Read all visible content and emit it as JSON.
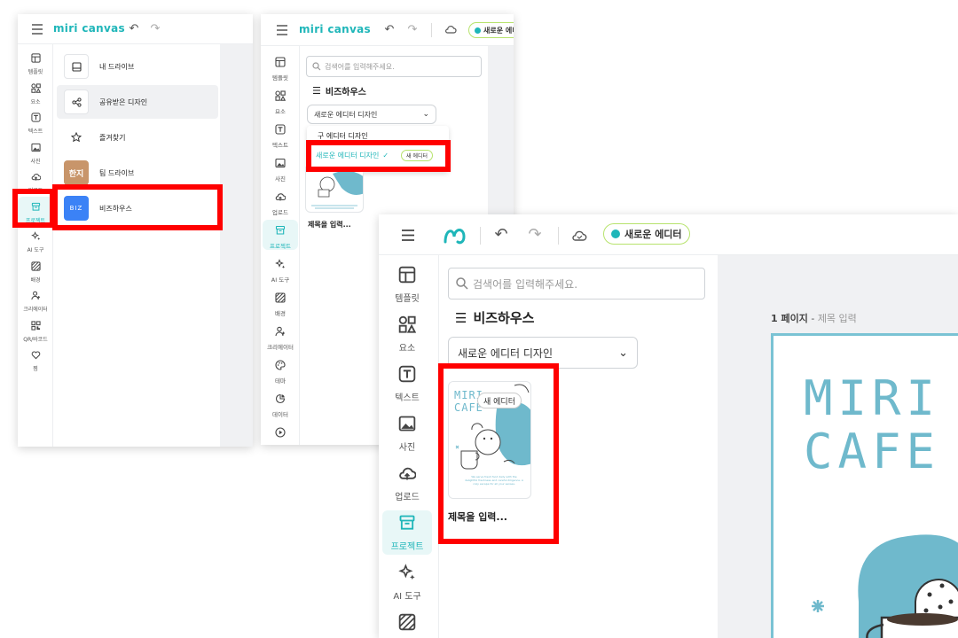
{
  "app": {
    "logo": "miri canvas"
  },
  "panel1": {
    "rail": [
      {
        "label": "템플릿",
        "icon": "template-icon"
      },
      {
        "label": "요소",
        "icon": "elements-icon"
      },
      {
        "label": "텍스트",
        "icon": "text-icon"
      },
      {
        "label": "사진",
        "icon": "photo-icon"
      },
      {
        "label": "업로드",
        "icon": "upload-icon"
      },
      {
        "label": "프로젝트",
        "icon": "project-icon"
      },
      {
        "label": "AI 도구",
        "icon": "ai-tool-icon"
      },
      {
        "label": "배경",
        "icon": "background-icon"
      },
      {
        "label": "크리에이터",
        "icon": "creator-icon"
      },
      {
        "label": "QR/바코드",
        "icon": "qr-icon"
      },
      {
        "label": "찜",
        "icon": "heart-icon"
      }
    ],
    "menu": [
      {
        "label": "내 드라이브",
        "icon": "drive-icon"
      },
      {
        "label": "공유받은 디자인",
        "icon": "share-icon"
      },
      {
        "label": "즐겨찾기",
        "icon": "star-icon"
      },
      {
        "label": "팀 드라이브",
        "icon": "team-badge",
        "badge": "한지"
      },
      {
        "label": "비즈하우스",
        "icon": "biz-badge",
        "badge": "Biz"
      }
    ]
  },
  "panel2": {
    "badge": "새로운 에디터",
    "search_placeholder": "검색어를 입력해주세요.",
    "section_title": "비즈하우스",
    "dropdown_value": "새로운 에디터 디자인",
    "dropdown_options": [
      {
        "label": "구 에디터 디자인"
      },
      {
        "label": "새로운 에디터 디자인",
        "badge": "새 에디터"
      }
    ],
    "thumb_title": "제목을 입력...",
    "rail": [
      {
        "label": "템플릿"
      },
      {
        "label": "요소"
      },
      {
        "label": "텍스트"
      },
      {
        "label": "사진"
      },
      {
        "label": "업로드"
      },
      {
        "label": "프로젝트"
      },
      {
        "label": "AI 도구"
      },
      {
        "label": "배경"
      },
      {
        "label": "크리에이터"
      },
      {
        "label": "테마"
      },
      {
        "label": "데이터"
      },
      {
        "label": "동영상"
      }
    ]
  },
  "panel3": {
    "badge": "새로운 에디터",
    "search_placeholder": "검색어를 입력해주세요.",
    "section_title": "비즈하우스",
    "dropdown_value": "새로운 에디터 디자인",
    "thumb_badge": "새 에디터",
    "thumb_title": "제목을 입력...",
    "thumb_art_title": "MIRI CAFE",
    "thumb_art_caption": "We serve fresh food daily with the delightful freshness and careful diligence. A cozy escape for all your senses.",
    "page_label": "1 페이지",
    "page_sep": " - ",
    "page_title_placeholder": "제목 입력",
    "canvas_text_line1": "MIRI",
    "canvas_text_line2": "CAFE",
    "rail": [
      {
        "label": "템플릿"
      },
      {
        "label": "요소"
      },
      {
        "label": "텍스트"
      },
      {
        "label": "사진"
      },
      {
        "label": "업로드"
      },
      {
        "label": "프로젝트"
      },
      {
        "label": "AI 도구"
      },
      {
        "label": "배경"
      }
    ]
  },
  "colors": {
    "accent": "#1fb6b9",
    "highlight": "#ff0000",
    "badge_border": "#b7e36d",
    "canvas_teal": "#6fb9cc"
  }
}
